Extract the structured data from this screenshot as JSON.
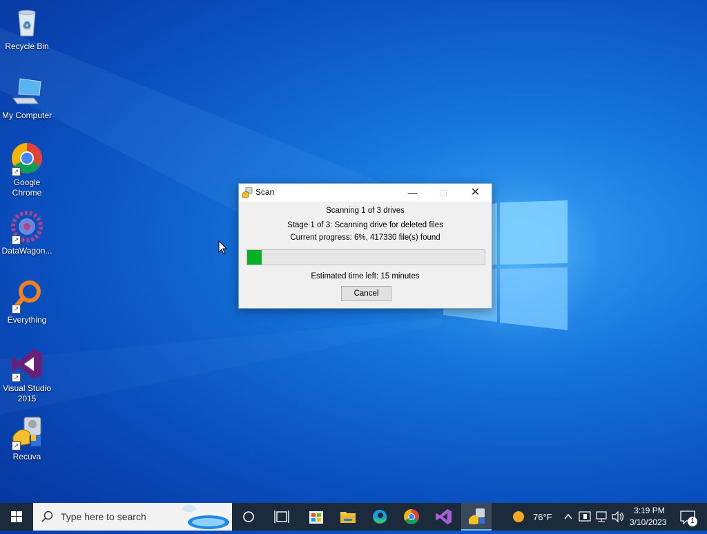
{
  "desktop": {
    "icons": [
      {
        "label": "Recycle Bin"
      },
      {
        "label": "My Computer"
      },
      {
        "label": "Google Chrome"
      },
      {
        "label": "DataWagon..."
      },
      {
        "label": "Everything"
      },
      {
        "label": "Visual Studio 2015"
      },
      {
        "label": "Recuva"
      }
    ]
  },
  "dialog": {
    "title": "Scan",
    "line1": "Scanning 1 of 3 drives",
    "line2": "Stage 1 of 3: Scanning drive for deleted files",
    "line3": "Current progress: 6%, 417330 file(s) found",
    "progress_percent": 6,
    "estimated": "Estimated time left: 15 minutes",
    "cancel_label": "Cancel"
  },
  "taskbar": {
    "search_placeholder": "Type here to search",
    "weather": "76°F",
    "time": "3:19 PM",
    "date": "3/10/2023",
    "notification_count": "1"
  },
  "colors": {
    "progress_fill": "#06b025",
    "taskbar_bg": "#1c2b3b"
  }
}
